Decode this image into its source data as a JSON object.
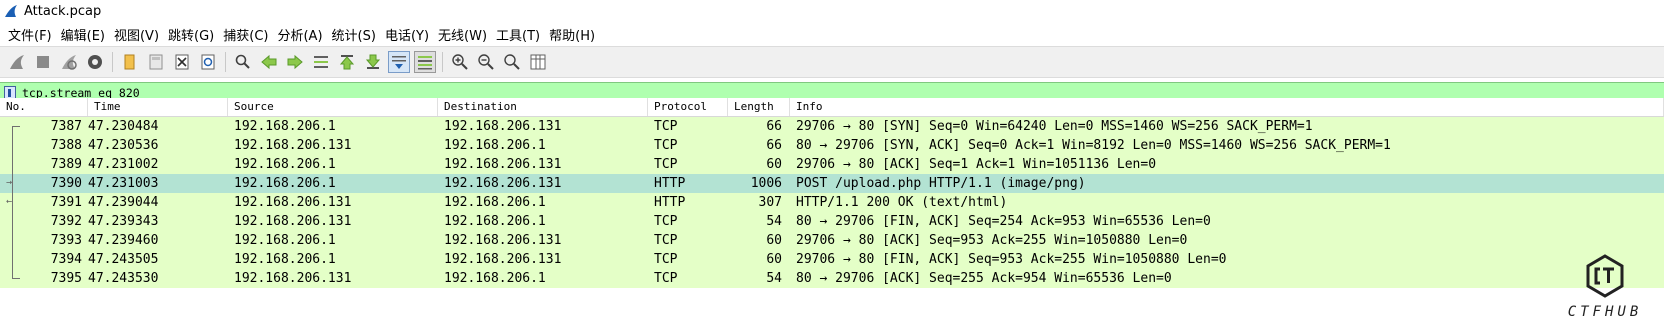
{
  "window": {
    "title": "Attack.pcap"
  },
  "menu": [
    "文件(F)",
    "编辑(E)",
    "视图(V)",
    "跳转(G)",
    "捕获(C)",
    "分析(A)",
    "统计(S)",
    "电话(Y)",
    "无线(W)",
    "工具(T)",
    "帮助(H)"
  ],
  "filter": {
    "value": "tcp.stream eq 820"
  },
  "columns": [
    "No.",
    "Time",
    "Source",
    "Destination",
    "Protocol",
    "Length",
    "Info"
  ],
  "rows": [
    {
      "no": "7387",
      "time": "47.230484",
      "src": "192.168.206.1",
      "dst": "192.168.206.131",
      "proto": "TCP",
      "len": "66",
      "info": "29706 → 80 [SYN] Seq=0 Win=64240 Len=0 MSS=1460 WS=256 SACK_PERM=1",
      "color": "#e4ffc7"
    },
    {
      "no": "7388",
      "time": "47.230536",
      "src": "192.168.206.131",
      "dst": "192.168.206.1",
      "proto": "TCP",
      "len": "66",
      "info": "80 → 29706 [SYN, ACK] Seq=0 Ack=1 Win=8192 Len=0 MSS=1460 WS=256 SACK_PERM=1",
      "color": "#e4ffc7"
    },
    {
      "no": "7389",
      "time": "47.231002",
      "src": "192.168.206.1",
      "dst": "192.168.206.131",
      "proto": "TCP",
      "len": "60",
      "info": "29706 → 80 [ACK] Seq=1 Ack=1 Win=1051136 Len=0",
      "color": "#e4ffc7"
    },
    {
      "no": "7390",
      "time": "47.231003",
      "src": "192.168.206.1",
      "dst": "192.168.206.131",
      "proto": "HTTP",
      "len": "1006",
      "info": "POST /upload.php HTTP/1.1  (image/png)",
      "color": "#b3e3d3"
    },
    {
      "no": "7391",
      "time": "47.239044",
      "src": "192.168.206.131",
      "dst": "192.168.206.1",
      "proto": "HTTP",
      "len": "307",
      "info": "HTTP/1.1 200 OK  (text/html)",
      "color": "#e4ffc7"
    },
    {
      "no": "7392",
      "time": "47.239343",
      "src": "192.168.206.131",
      "dst": "192.168.206.1",
      "proto": "TCP",
      "len": "54",
      "info": "80 → 29706 [FIN, ACK] Seq=254 Ack=953 Win=65536 Len=0",
      "color": "#e4ffc7"
    },
    {
      "no": "7393",
      "time": "47.239460",
      "src": "192.168.206.1",
      "dst": "192.168.206.131",
      "proto": "TCP",
      "len": "60",
      "info": "29706 → 80 [ACK] Seq=953 Ack=255 Win=1050880 Len=0",
      "color": "#e4ffc7"
    },
    {
      "no": "7394",
      "time": "47.243505",
      "src": "192.168.206.1",
      "dst": "192.168.206.131",
      "proto": "TCP",
      "len": "60",
      "info": "29706 → 80 [FIN, ACK] Seq=953 Ack=255 Win=1050880 Len=0",
      "color": "#e4ffc7"
    },
    {
      "no": "7395",
      "time": "47.243530",
      "src": "192.168.206.131",
      "dst": "192.168.206.1",
      "proto": "TCP",
      "len": "54",
      "info": "80 → 29706 [ACK] Seq=255 Ack=954 Win=65536 Len=0",
      "color": "#e4ffc7"
    }
  ],
  "watermark": {
    "text": "CTFHUB"
  },
  "icons": [
    "shark-fin-icon",
    "start-capture-icon",
    "stop-capture-icon",
    "restart-capture-icon",
    "capture-options-icon",
    "open-file-icon",
    "save-file-icon",
    "close-file-icon",
    "reload-icon",
    "find-icon",
    "go-back-icon",
    "go-forward-icon",
    "go-to-packet-icon",
    "first-packet-icon",
    "last-packet-icon",
    "auto-scroll-icon",
    "colorize-icon",
    "zoom-in-icon",
    "zoom-out-icon",
    "normal-size-icon",
    "resize-columns-icon",
    "bookmark-icon"
  ]
}
